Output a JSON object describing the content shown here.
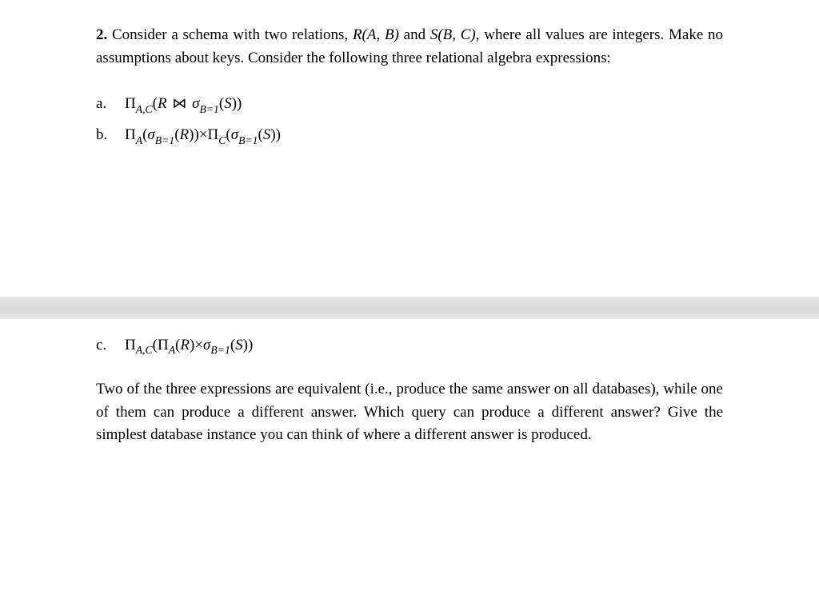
{
  "question": {
    "number": "2.",
    "intro_part1": "Consider a schema with two relations, ",
    "relation1": "R(A, B)",
    "intro_part2": " and ",
    "relation2": "S(B, C)",
    "intro_part3": ", where all values are integers. Make no assumptions about keys. Consider the following three relational algebra expressions:"
  },
  "expressions": {
    "a": {
      "label": "a.",
      "pi": "Π",
      "pi_sub": "A,C",
      "open": "(",
      "R": "R",
      "join": "⋈",
      "sigma": "σ",
      "sigma_sub": "B=1",
      "S": "S",
      "close_inner": ")",
      "close_outer": ")"
    },
    "b": {
      "label": "b.",
      "pi1": "Π",
      "pi1_sub": "A",
      "open1": "(",
      "sigma1": "σ",
      "sigma1_sub": "B=1",
      "R": "R",
      "close1": ")",
      "close1b": ")",
      "times": "×",
      "pi2": "Π",
      "pi2_sub": "C",
      "open2": "(",
      "sigma2": "σ",
      "sigma2_sub": "B=1",
      "S": "S",
      "close2": ")",
      "close2b": ")"
    },
    "c": {
      "label": "c.",
      "pi": "Π",
      "pi_sub": "A,C",
      "open": "(",
      "pi_inner": "Π",
      "pi_inner_sub": "A",
      "open_inner": "(",
      "R": "R",
      "close_inner": ")",
      "times": "×",
      "sigma": "σ",
      "sigma_sub": "B=1",
      "open_s": "(",
      "S": "S",
      "close_s": ")",
      "close_outer": ")"
    }
  },
  "conclusion": "Two of the three expressions are equivalent (i.e., produce the same answer on all databases), while one of them can produce a different answer. Which query can produce a different answer? Give the simplest database instance you can think of where a different answer is produced."
}
